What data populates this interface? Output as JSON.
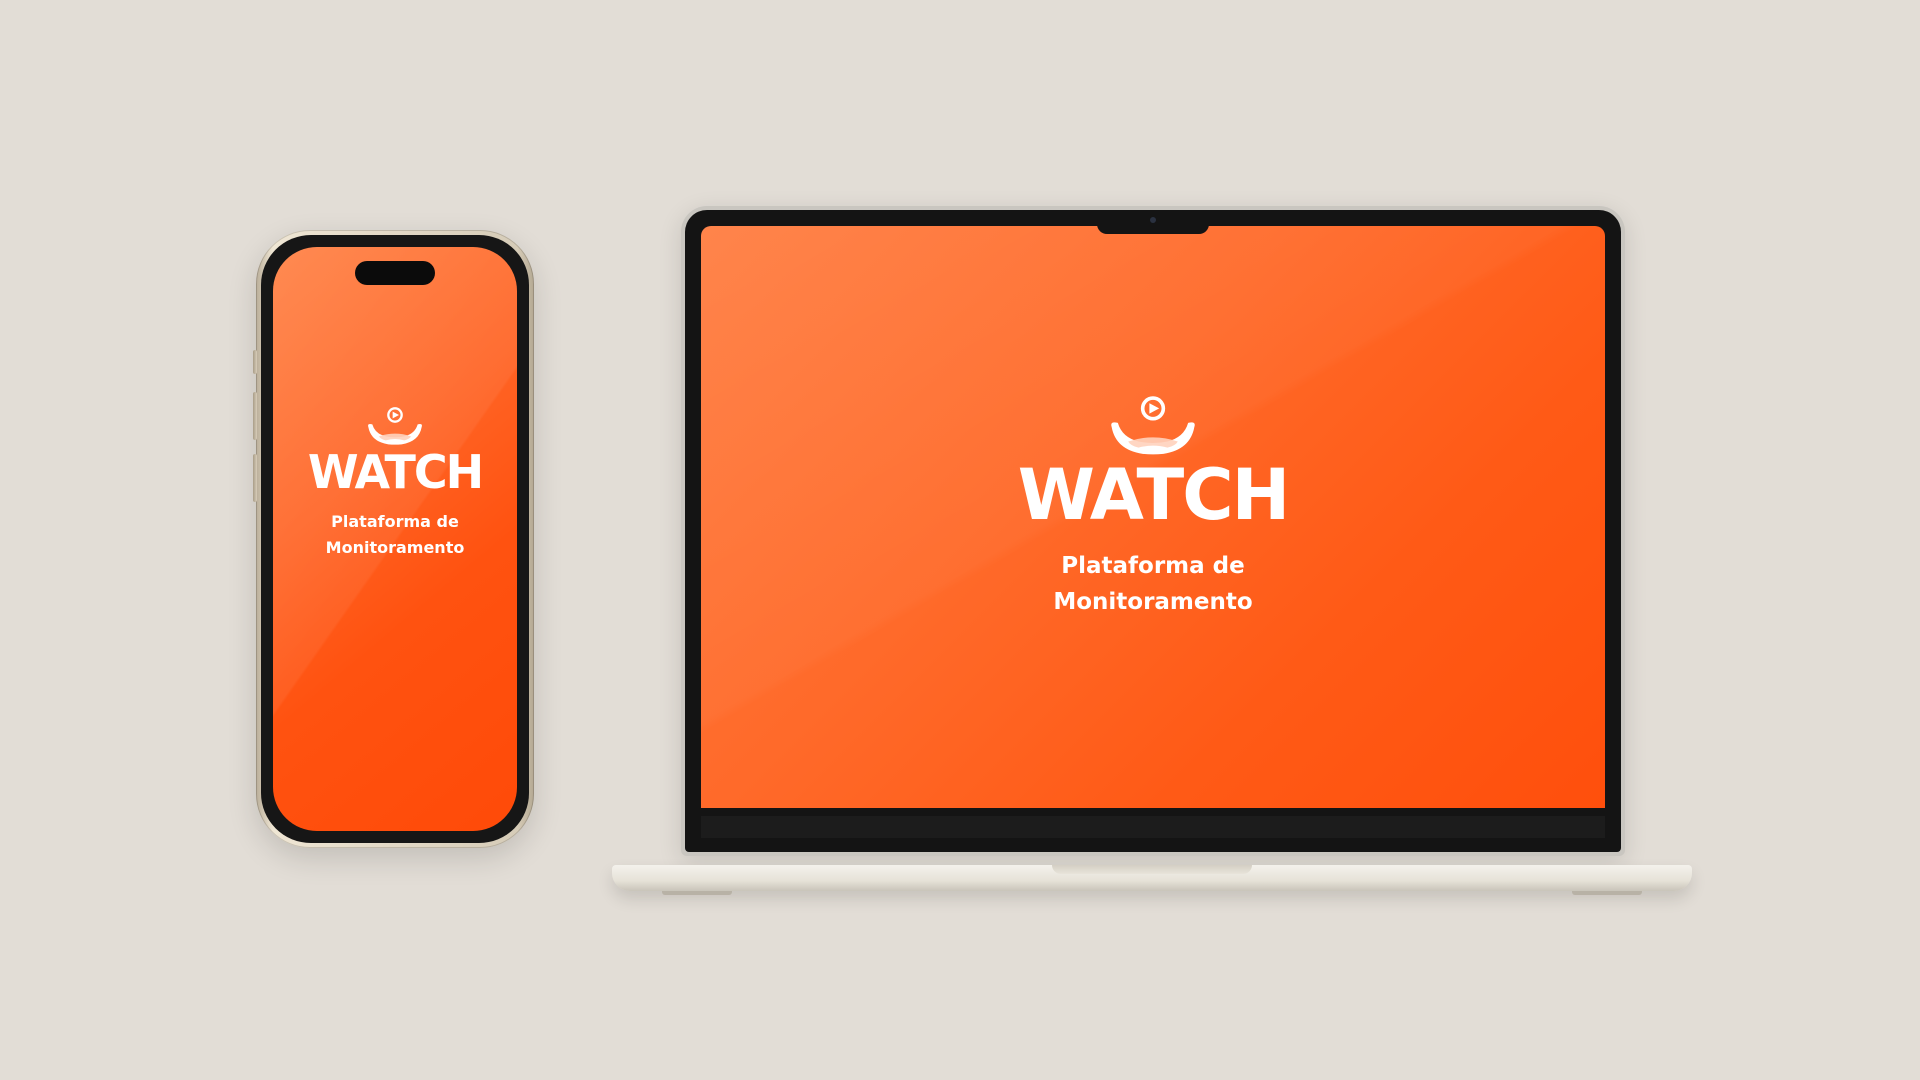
{
  "scene": {
    "background_color": "#e2ddd6",
    "accent_color": "#ff5a16"
  },
  "phone": {
    "app_name": "WATCH",
    "tagline_line1": "Plataforma de",
    "tagline_line2": "Monitoramento",
    "logo_icon": "play-crown-icon"
  },
  "laptop": {
    "app_name": "WATCH",
    "tagline_line1": "Plataforma de",
    "tagline_line2": "Monitoramento",
    "logo_icon": "play-crown-icon"
  }
}
